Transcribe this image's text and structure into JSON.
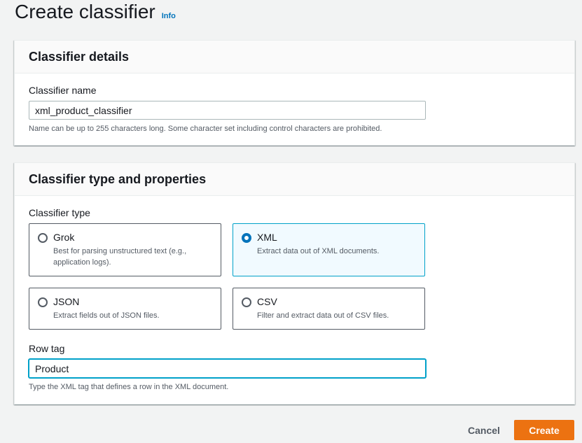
{
  "page": {
    "title": "Create classifier",
    "info_label": "Info"
  },
  "details_panel": {
    "title": "Classifier details",
    "name_label": "Classifier name",
    "name_value": "xml_product_classifier",
    "name_hint": "Name can be up to 255 characters long. Some character set including control characters are prohibited."
  },
  "type_panel": {
    "title": "Classifier type and properties",
    "type_label": "Classifier type",
    "selected_type": "XML",
    "options": [
      {
        "title": "Grok",
        "description": "Best for parsing unstructured text (e.g., application logs).",
        "selected": false
      },
      {
        "title": "XML",
        "description": "Extract data out of XML documents.",
        "selected": true
      },
      {
        "title": "JSON",
        "description": "Extract fields out of JSON files.",
        "selected": false
      },
      {
        "title": "CSV",
        "description": "Filter and extract data out of CSV files.",
        "selected": false
      }
    ],
    "row_tag_label": "Row tag",
    "row_tag_value": "Product",
    "row_tag_hint": "Type the XML tag that defines a row in the XML document."
  },
  "footer": {
    "cancel_label": "Cancel",
    "create_label": "Create"
  },
  "colors": {
    "primary_button": "#ec7211",
    "link": "#0073bb",
    "selected_tile_border": "#00a1c9",
    "selected_tile_bg": "#f1faff"
  }
}
